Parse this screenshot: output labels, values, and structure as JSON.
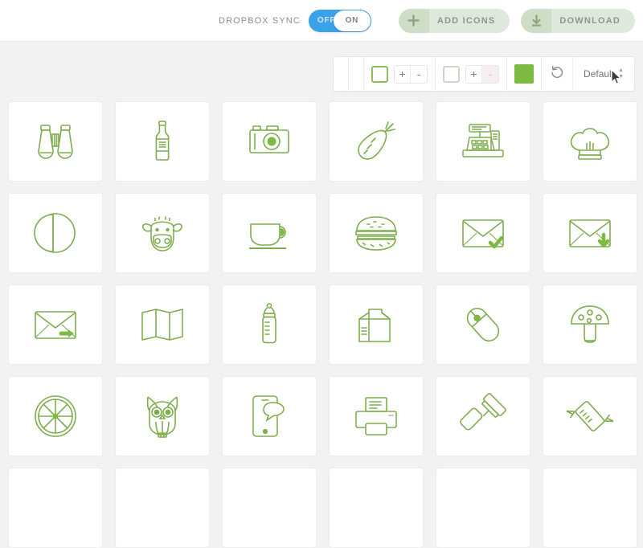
{
  "header": {
    "sync_label": "DROPBOX SYNC",
    "toggle": {
      "off_label": "OFF",
      "on_label": "ON",
      "state": "on",
      "track_color": "#3ba2e8"
    },
    "add_icons_button": {
      "label": "ADD ICONS",
      "icon": "plus-icon"
    },
    "download_button": {
      "label": "DOWNLOAD",
      "icon": "download-arrow-icon"
    }
  },
  "toolbar": {
    "blank_cell_1": "",
    "blank_cell_2": "",
    "stroke_group": {
      "swatch_name": "stroke-color-square",
      "swatch_border_color": "#8cbf5a",
      "plus_label": "+",
      "minus_label": "-"
    },
    "fill_group": {
      "swatch_name": "fill-color-square",
      "swatch_border_color": "#cdd6c8",
      "plus_label": "+",
      "minus_label": "-",
      "minus_disabled": true
    },
    "color_swatch": {
      "name": "active-color-swatch",
      "color": "#7cbb42"
    },
    "reset_button": {
      "name": "reset-icon"
    },
    "preset_select": {
      "value": "Default"
    }
  },
  "grid": {
    "columns": 6,
    "icons": [
      {
        "id": "binoculars",
        "label": "binoculars-icon"
      },
      {
        "id": "bottle",
        "label": "wine-bottle-icon"
      },
      {
        "id": "camera",
        "label": "camera-icon"
      },
      {
        "id": "carrot",
        "label": "carrot-icon"
      },
      {
        "id": "cash-register",
        "label": "cash-register-icon"
      },
      {
        "id": "chef-hat",
        "label": "chef-hat-icon"
      },
      {
        "id": "contrast",
        "label": "contrast-circle-icon"
      },
      {
        "id": "cow",
        "label": "cow-icon"
      },
      {
        "id": "coffee-cup",
        "label": "coffee-cup-icon"
      },
      {
        "id": "burger",
        "label": "hamburger-icon"
      },
      {
        "id": "email-check",
        "label": "email-check-icon"
      },
      {
        "id": "email-download",
        "label": "email-download-icon"
      },
      {
        "id": "email-forward",
        "label": "email-forward-icon"
      },
      {
        "id": "map",
        "label": "folded-map-icon"
      },
      {
        "id": "baby-bottle",
        "label": "baby-bottle-icon"
      },
      {
        "id": "milk-carton",
        "label": "milk-carton-icon"
      },
      {
        "id": "mouse",
        "label": "computer-mouse-icon"
      },
      {
        "id": "mushroom",
        "label": "mushroom-icon"
      },
      {
        "id": "lime",
        "label": "lime-slice-icon"
      },
      {
        "id": "owl",
        "label": "owl-icon"
      },
      {
        "id": "phone-message",
        "label": "phone-message-icon"
      },
      {
        "id": "printer",
        "label": "printer-icon"
      },
      {
        "id": "paint-roller",
        "label": "paint-roller-icon"
      },
      {
        "id": "candy",
        "label": "candy-icon"
      },
      {
        "id": "row5-1",
        "label": "icon-partial-1"
      },
      {
        "id": "row5-2",
        "label": "icon-partial-2"
      },
      {
        "id": "row5-3",
        "label": "icon-partial-3"
      },
      {
        "id": "row5-4",
        "label": "icon-partial-4"
      },
      {
        "id": "row5-5",
        "label": "icon-partial-5"
      },
      {
        "id": "row5-6",
        "label": "icon-partial-6"
      }
    ]
  },
  "theme": {
    "icon_stroke": "#7fad4e",
    "icon_accent": "#7cbb42",
    "page_bg": "#f1f3f1",
    "card_bg": "#ffffff"
  }
}
